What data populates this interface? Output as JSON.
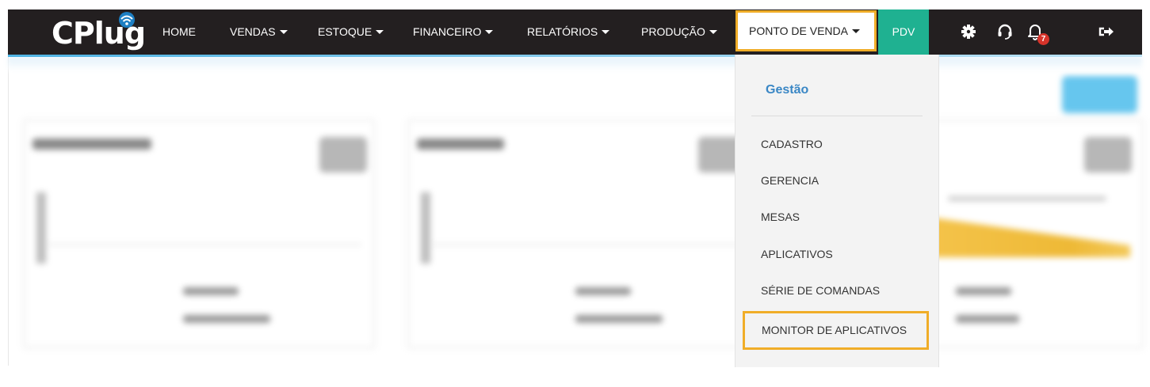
{
  "navbar": {
    "logo_text": "CPlug",
    "items": [
      {
        "label": "HOME",
        "has_caret": false
      },
      {
        "label": "VENDAS",
        "has_caret": true
      },
      {
        "label": "ESTOQUE",
        "has_caret": true
      },
      {
        "label": "FINANCEIRO",
        "has_caret": true
      },
      {
        "label": "RELATÓRIOS",
        "has_caret": true
      },
      {
        "label": "PRODUÇÃO",
        "has_caret": true
      },
      {
        "label": "PONTO DE VENDA",
        "has_caret": true,
        "active": true
      }
    ],
    "pdv_label": "PDV",
    "notification_count": "7",
    "icons": [
      "gear-icon",
      "headset-icon",
      "bell-icon",
      "logout-icon"
    ],
    "colors": {
      "background": "#231f20",
      "pdv": "#1fb191",
      "highlight": "#f0ad28",
      "badge": "#d6332a"
    }
  },
  "dropdown": {
    "header": "Gestão",
    "items": [
      "CADASTRO",
      "GERENCIA",
      "MESAS",
      "APLICATIVOS",
      "SÉRIE DE COMANDAS",
      "MONITOR DE APLICATIVOS"
    ],
    "highlighted_item": "MONITOR DE APLICATIVOS"
  }
}
